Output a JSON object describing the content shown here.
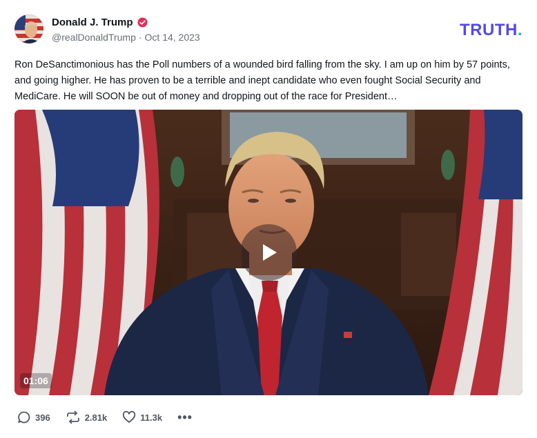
{
  "author": {
    "display_name": "Donald J. Trump",
    "handle": "@realDonaldTrump",
    "separator": "·",
    "date": "Oct 14, 2023",
    "verified_icon": "verified-badge-icon",
    "verified_color": "#e0315a"
  },
  "brand": {
    "logo_text": "TRUTH",
    "logo_dot": ".",
    "logo_color": "#5448ee",
    "dot_color": "#17c3a7"
  },
  "post": {
    "text": "Ron DeSanctimonious has the Poll numbers of a wounded bird falling from the sky. I am up on him by 57 points, and going higher. He has proven to be a terrible and inept candidate who even fought Social Security and MediCare. He will SOON be out of money and dropping out of the race for President…"
  },
  "video": {
    "duration": "01:06",
    "play_icon": "play-icon"
  },
  "actions": {
    "replies": "396",
    "retruths": "2.81k",
    "likes": "11.3k",
    "reply_icon": "comment-icon",
    "retruth_icon": "repost-icon",
    "like_icon": "heart-icon",
    "more_icon": "more-icon",
    "more_label": "•••"
  }
}
